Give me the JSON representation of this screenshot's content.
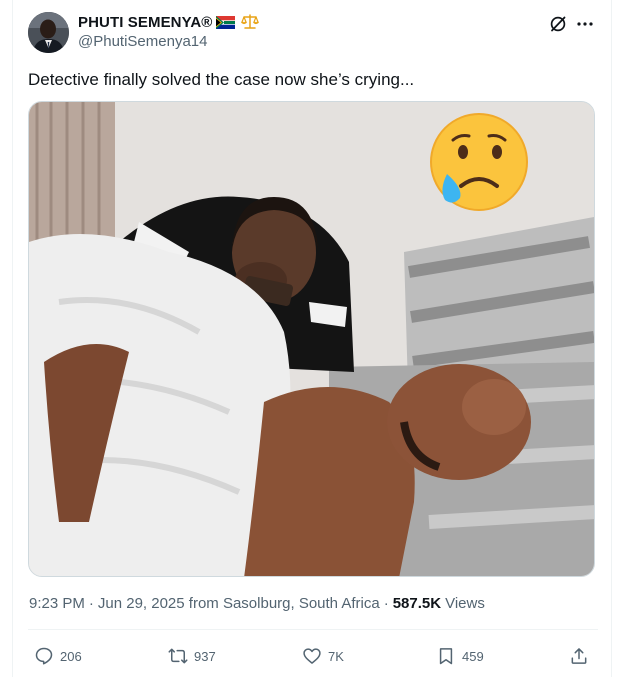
{
  "user": {
    "display_name": "PHUTI SEMENYA®",
    "handle": "@PhutiSemenya14"
  },
  "tweet": {
    "text": "Detective finally solved the case now she’s crying..."
  },
  "meta": {
    "time": "9:23 PM",
    "separator1": "·",
    "date_location": "Jun 29, 2025 from Sasolburg, South Africa",
    "separator2": "·",
    "views_count": "587.5K",
    "views_label": "Views"
  },
  "actions": {
    "replies": "206",
    "reposts": "937",
    "likes": "7K",
    "bookmarks": "459"
  },
  "icons": {
    "flag": "south-africa-flag-icon",
    "scales": "scales-icon",
    "grok": "grok-icon",
    "more": "more-icon",
    "reply": "reply-icon",
    "repost": "repost-icon",
    "like": "heart-icon",
    "bookmark": "bookmark-icon",
    "share": "share-icon",
    "emoji": "crying-face-emoji"
  },
  "colors": {
    "text": "#0f1419",
    "secondary": "#536471",
    "border": "#eff3f4"
  }
}
